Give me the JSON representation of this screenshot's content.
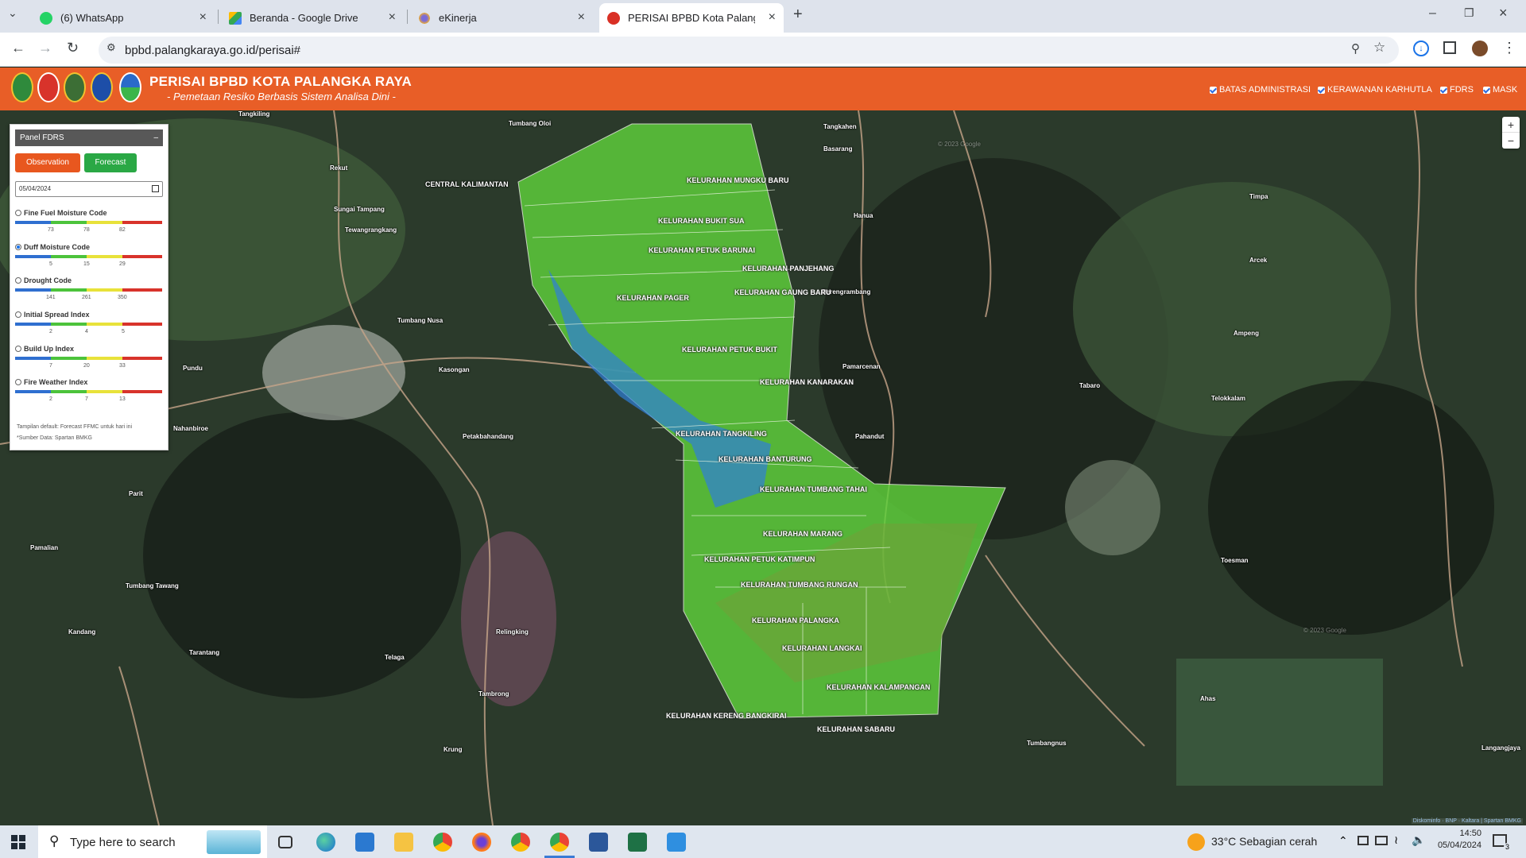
{
  "browser": {
    "tabs": [
      {
        "title": "(6) WhatsApp",
        "icon": "whatsapp-icon"
      },
      {
        "title": "Beranda - Google Drive",
        "icon": "google-drive-icon"
      },
      {
        "title": "eKinerja",
        "icon": "ekinerja-icon"
      },
      {
        "title": "PERISAI BPBD Kota Palangka Ra",
        "icon": "bpbd-icon",
        "active": true
      }
    ],
    "url": "bpbd.palangkaraya.go.id/perisai#"
  },
  "header": {
    "title": "PERISAI BPBD KOTA PALANGKA RAYA",
    "subtitle": "- Pemetaan Resiko Berbasis Sistem Analisa Dini -",
    "layers": [
      "BATAS ADMINISTRASI",
      "KERAWANAN KARHUTLA",
      "FDRS",
      "MASK"
    ]
  },
  "panel": {
    "title": "Panel FDRS",
    "observation_label": "Observation",
    "forecast_label": "Forecast",
    "date_value": "05/04/2024",
    "indices": [
      {
        "name": "Fine Fuel Moisture Code",
        "ticks": [
          "73",
          "78",
          "82"
        ],
        "selected": false
      },
      {
        "name": "Duff Moisture Code",
        "ticks": [
          "5",
          "15",
          "29"
        ],
        "selected": true
      },
      {
        "name": "Drought Code",
        "ticks": [
          "141",
          "261",
          "350"
        ],
        "selected": false
      },
      {
        "name": "Initial Spread Index",
        "ticks": [
          "2",
          "4",
          "5"
        ],
        "selected": false
      },
      {
        "name": "Build Up Index",
        "ticks": [
          "7",
          "20",
          "33"
        ],
        "selected": false
      },
      {
        "name": "Fire Weather Index",
        "ticks": [
          "2",
          "7",
          "13"
        ],
        "selected": false
      }
    ],
    "note_default": "Tampilan default: Forecast FFMC untuk hari ini",
    "note_source": "*Sumber Data: Spartan BMKG",
    "colors": {
      "blue": "#2f6fd0",
      "green": "#4cc33b",
      "yellow": "#e8e23a",
      "red": "#d8332b",
      "observation": "#e8571f",
      "forecast": "#2aa845"
    }
  },
  "map": {
    "place_labels": [
      "Tangkahen",
      "Tumbang Oloi",
      "Tangkiling",
      "CENTRAL KALIMANTAN",
      "Rekut",
      "Tewangrangkang",
      "Tumbang Nusa",
      "Kasongan",
      "Pundu",
      "Tarantang",
      "Petakbahandang",
      "Nahanbiroe",
      "Parit",
      "Pamalian",
      "Tumbang Tawang",
      "Kandang",
      "Telaga",
      "Timpa",
      "Arcek",
      "Ampeng",
      "Hanua",
      "Basarang",
      "Berengrambang",
      "Pamarcenan",
      "Pahandut",
      "Tabaro",
      "Telokkalam",
      "Toesman",
      "Ahas",
      "Tumbangnus",
      "Langangjaya",
      "Krung",
      "Relingking",
      "Tambrong",
      "Sungai Tampang"
    ],
    "kelurahan": [
      "KELURAHAN MUNGKU BARU",
      "KELURAHAN BUKIT SUA",
      "KELURAHAN PETUK BARUNAI",
      "KELURAHAN PANJEHANG",
      "KELURAHAN GAUNG BARU",
      "KELURAHAN PAGER",
      "KELURAHAN PETUK BUKIT",
      "KELURAHAN KANARAKAN",
      "KELURAHAN TANGKILING",
      "KELURAHAN BANTURUNG",
      "KELURAHAN TUMBANG TAHAI",
      "KELURAHAN MARANG",
      "KELURAHAN PETUK KATIMPUN",
      "KELURAHAN TUMBANG RUNGAN",
      "KELURAHAN PALANGKA",
      "KELURAHAN LANGKAI",
      "KELURAHAN KALAMPANGAN",
      "KELURAHAN KERENG BANGKIRAI",
      "KELURAHAN SABARU"
    ],
    "watermark": "© 2023 Google",
    "attribution": "Diskominfo · BNP · Kaltara | Spartan BMKG",
    "zoom_in": "+",
    "zoom_out": "−"
  },
  "taskbar": {
    "search_placeholder": "Type here to search",
    "weather": "33°C  Sebagian cerah",
    "time": "14:50",
    "date": "05/04/2024",
    "notifications": "3"
  }
}
